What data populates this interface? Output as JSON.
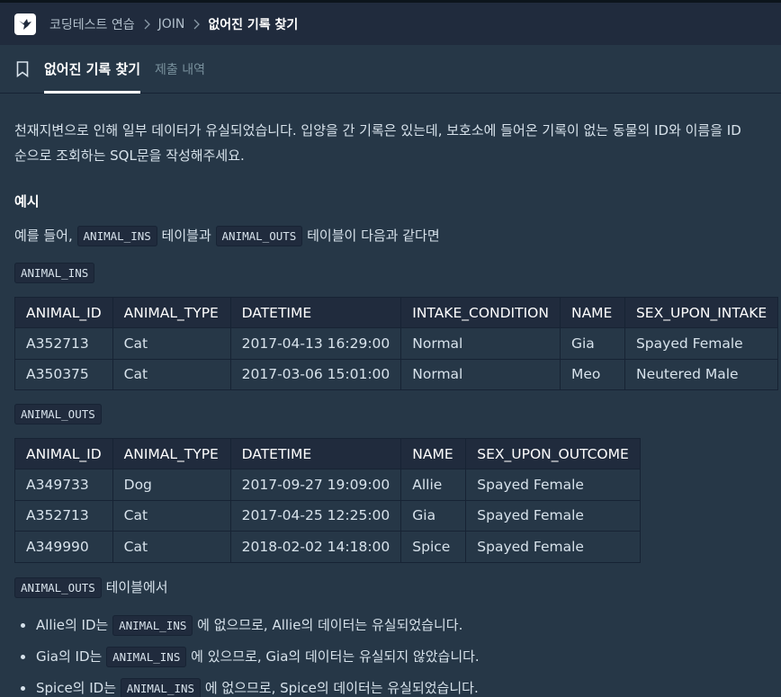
{
  "breadcrumb": {
    "items": [
      "코딩테스트 연습",
      "JOIN"
    ],
    "current": "없어진 기록 찾기"
  },
  "tabs": {
    "active": "없어진 기록 찾기",
    "inactive": "제출 내역"
  },
  "description": {
    "line1": "천재지변으로 인해 일부 데이터가 유실되었습니다. 입양을 간 기록은 있는데, 보호소에 들어온 기록이 없는 동물의 ID와 이름을 ID",
    "line2": "순으로 조회하는 SQL문을 작성해주세요."
  },
  "example": {
    "heading": "예시",
    "intro_prefix": "예를 들어, ",
    "intro_code1": "ANIMAL_INS",
    "intro_mid": " 테이블과 ",
    "intro_code2": "ANIMAL_OUTS",
    "intro_suffix": " 테이블이 다음과 같다면"
  },
  "ins_table": {
    "label": "ANIMAL_INS",
    "headers": [
      "ANIMAL_ID",
      "ANIMAL_TYPE",
      "DATETIME",
      "INTAKE_CONDITION",
      "NAME",
      "SEX_UPON_INTAKE"
    ],
    "rows": [
      [
        "A352713",
        "Cat",
        "2017-04-13 16:29:00",
        "Normal",
        "Gia",
        "Spayed Female"
      ],
      [
        "A350375",
        "Cat",
        "2017-03-06 15:01:00",
        "Normal",
        "Meo",
        "Neutered Male"
      ]
    ]
  },
  "outs_table": {
    "label": "ANIMAL_OUTS",
    "headers": [
      "ANIMAL_ID",
      "ANIMAL_TYPE",
      "DATETIME",
      "NAME",
      "SEX_UPON_OUTCOME"
    ],
    "rows": [
      [
        "A349733",
        "Dog",
        "2017-09-27 19:09:00",
        "Allie",
        "Spayed Female"
      ],
      [
        "A352713",
        "Cat",
        "2017-04-25 12:25:00",
        "Gia",
        "Spayed Female"
      ],
      [
        "A349990",
        "Cat",
        "2018-02-02 14:18:00",
        "Spice",
        "Spayed Female"
      ]
    ]
  },
  "outs_note": {
    "code": "ANIMAL_OUTS",
    "text": " 테이블에서"
  },
  "bullets": [
    {
      "prefix": "Allie의 ID는 ",
      "code": "ANIMAL_INS",
      "suffix": " 에 없으므로, Allie의 데이터는 유실되었습니다."
    },
    {
      "prefix": "Gia의 ID는 ",
      "code": "ANIMAL_INS",
      "suffix": " 에 있으므로, Gia의 데이터는 유실되지 않았습니다."
    },
    {
      "prefix": "Spice의 ID는 ",
      "code": "ANIMAL_INS",
      "suffix": " 에 없으므로, Spice의 데이터는 유실되었습니다."
    }
  ],
  "icons": {
    "logo": "programmers-bird-logo",
    "chevron": "chevron-right-icon",
    "bookmark": "bookmark-icon"
  },
  "colors": {
    "topbar": "#202b3d",
    "background": "#263747",
    "text": "#d7e2eb",
    "border": "#172334"
  }
}
